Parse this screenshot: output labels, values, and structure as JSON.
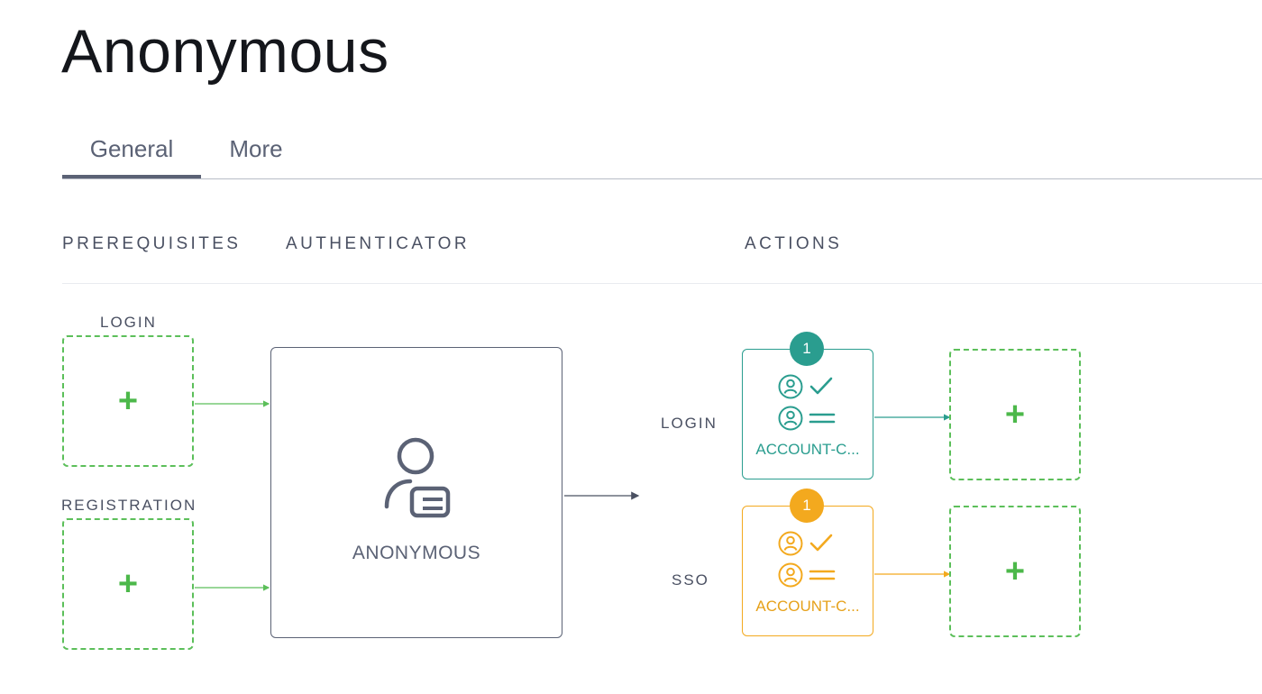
{
  "page": {
    "title": "Anonymous"
  },
  "tabs": [
    {
      "label": "General",
      "active": true
    },
    {
      "label": "More",
      "active": false
    }
  ],
  "sections": {
    "prerequisites": "PREREQUISITES",
    "authenticator": "AUTHENTICATOR",
    "actions": "ACTIONS"
  },
  "prerequisites": [
    {
      "label": "LOGIN",
      "add_symbol": "+"
    },
    {
      "label": "REGISTRATION",
      "add_symbol": "+"
    }
  ],
  "authenticator": {
    "label": "ANONYMOUS",
    "icon": "user-card-icon"
  },
  "actions": [
    {
      "row_label": "LOGIN",
      "badge": "1",
      "card_label": "ACCOUNT-C...",
      "color": "#2a9d8f",
      "next_add_symbol": "+"
    },
    {
      "row_label": "SSO",
      "badge": "1",
      "card_label": "ACCOUNT-C...",
      "color": "#f3a91e",
      "next_add_symbol": "+"
    }
  ],
  "colors": {
    "add_green": "#5cbf5a",
    "text_muted": "#5b6275",
    "teal": "#2a9d8f",
    "orange": "#f3a91e"
  }
}
